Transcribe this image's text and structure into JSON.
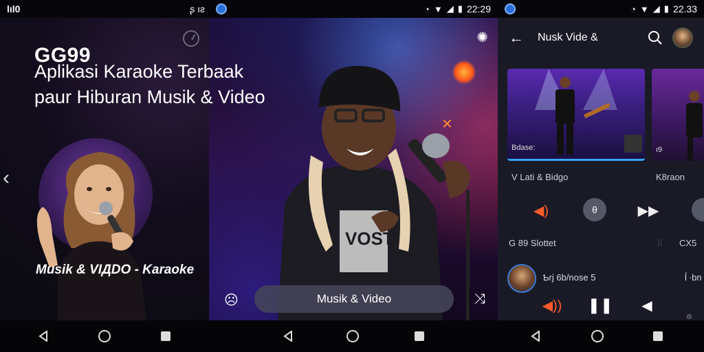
{
  "statusbar": {
    "left_panel_badge": "lıl0",
    "left_panel_icons": "ʂ ıƨ",
    "middle_time": "22:29",
    "right_time": "22.33"
  },
  "panel1": {
    "brand": "GG99",
    "headline_line1": "Aplikasi Karaoke Terbaak",
    "headline_line2": "paur Hiburan Musik & Video",
    "caption": "Musik & VIДDO - Karaoke"
  },
  "panel2": {
    "pill_label": "Musik & Video"
  },
  "panel3": {
    "title": "Nusk Vide &",
    "thumb1_label": "Bdase:",
    "thumb2_label": "ı9",
    "row_left": "V Lati & Bidgo",
    "row_right": "K8raon",
    "stat_left": "G 89 Slottet",
    "stat_middle": "⁞⁞",
    "stat_right": "CX5",
    "np_title": "Ƅrj 6b/nose 5",
    "np_right": "ĺ ∙bn"
  },
  "colors": {
    "accent_blue": "#36a6ff",
    "accent_orange": "#ff5a2a",
    "panel3_bg": "#191a26"
  }
}
